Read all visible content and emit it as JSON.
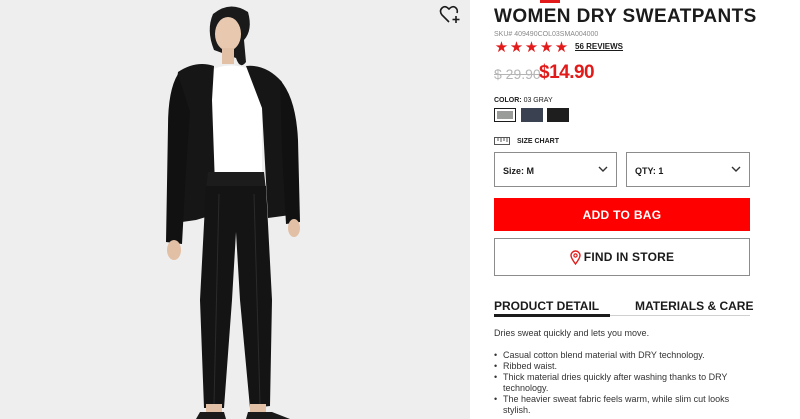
{
  "product": {
    "title": "WOMEN DRY SWEATPANTS",
    "sku": "SKU# 409490COL03SMA004000",
    "rating_stars": 5,
    "reviews": "56 REVIEWS",
    "price_old": "$ 29.90",
    "price_new": "$14.90"
  },
  "color": {
    "label": "COLOR:",
    "value": "03 GRAY",
    "swatches": [
      {
        "name": "gray",
        "hex": "#9a9c9a",
        "selected": true
      },
      {
        "name": "navy",
        "hex": "#3a4150",
        "selected": false
      },
      {
        "name": "black",
        "hex": "#1e1e1e",
        "selected": false
      }
    ]
  },
  "size_chart": "SIZE CHART",
  "selectors": {
    "size": "Size: M",
    "qty": "QTY: 1"
  },
  "actions": {
    "add_to_bag": "ADD TO BAG",
    "find_in_store": "FIND IN STORE"
  },
  "tabs": {
    "detail": "PRODUCT DETAIL",
    "materials": "MATERIALS & CARE",
    "active": "detail"
  },
  "description": "Dries sweat quickly and lets you move.",
  "features": [
    "Casual cotton blend material with DRY technology.",
    "Ribbed waist.",
    "Thick material dries quickly after washing thanks to DRY technology.",
    "The heavier sweat fabric feels warm, while slim cut looks stylish."
  ],
  "icons": {
    "wishlist": "heart-plus-icon",
    "location": "map-pin-icon",
    "ruler": "ruler-icon",
    "chevron": "chevron-down-icon"
  },
  "colors": {
    "accent": "#ff0000",
    "star": "#e21a1a",
    "photo_bg": "#eeeeee"
  }
}
